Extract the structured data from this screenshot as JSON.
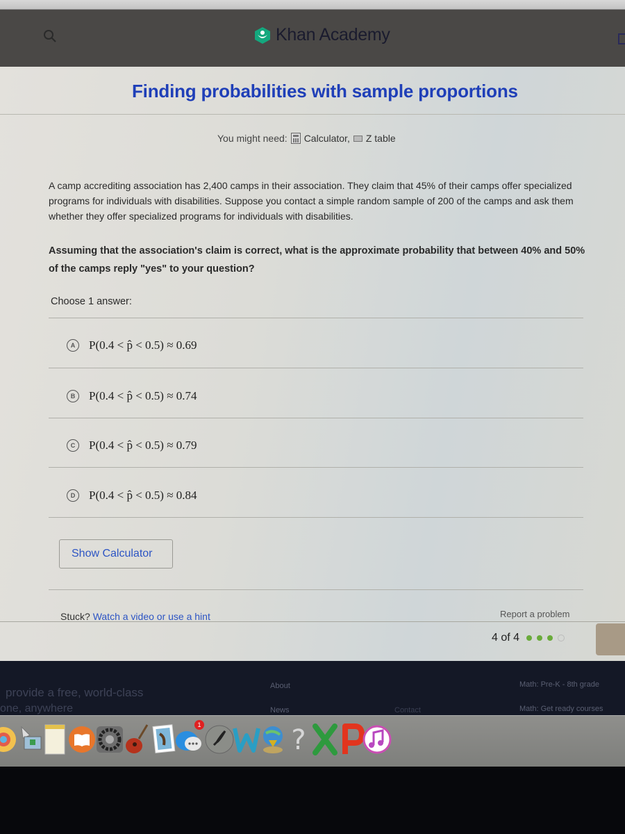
{
  "header": {
    "brand": "Khan Academy",
    "brand_color": "#14bf96"
  },
  "exercise": {
    "title": "Finding probabilities with sample proportions",
    "might_need_label": "You might need:",
    "tools": [
      {
        "label": "Calculator,",
        "icon": "calculator-icon"
      },
      {
        "label": "Z table",
        "icon": "table-icon"
      }
    ],
    "problem_text": "A camp accrediting association has 2,400 camps in their association. They claim that 45% of their camps offer specialized programs for individuals with disabilities. Suppose you contact a simple random sample of 200 of the camps and ask them whether they offer specialized programs for individuals with disabilities.",
    "question_text": "Assuming that the association's claim is correct, what is the approximate probability that between 40% and 50% of the camps reply \"yes\" to your question?",
    "choose_label": "Choose 1 answer:",
    "choices": [
      {
        "letter": "A",
        "text": "P(0.4 < p̂ < 0.5) ≈ 0.69"
      },
      {
        "letter": "B",
        "text": "P(0.4 < p̂ < 0.5) ≈ 0.74"
      },
      {
        "letter": "C",
        "text": "P(0.4 < p̂ < 0.5) ≈ 0.79"
      },
      {
        "letter": "D",
        "text": "P(0.4 < p̂ < 0.5) ≈ 0.84"
      }
    ],
    "show_calculator_label": "Show Calculator",
    "stuck_label": "Stuck?",
    "hint_link": "Watch a video or use a hint",
    "report_link": "Report a problem",
    "progress_text": "4 of 4",
    "progress": {
      "completed": 3,
      "total": 4
    },
    "accent_color": "#1f3fb8",
    "progress_dot_color": "#6aab3b"
  },
  "footer": {
    "mission_line1": "provide a free, world-class",
    "mission_line2": "one, anywhere",
    "links": {
      "about": "About",
      "news": "News",
      "contact": "Contact",
      "math_prek": "Math: Pre-K - 8th grade",
      "math_ready": "Math: Get ready courses"
    }
  },
  "dock": {
    "items": [
      {
        "name": "photos",
        "icon": "photos-icon"
      },
      {
        "name": "boot-camp",
        "icon": "boot-camp-icon"
      },
      {
        "name": "notes",
        "icon": "notes-icon"
      },
      {
        "name": "books",
        "icon": "books-icon"
      },
      {
        "name": "system-preferences",
        "icon": "gear-icon"
      },
      {
        "name": "garageband",
        "icon": "guitar-icon"
      },
      {
        "name": "mail",
        "icon": "mail-stamp-icon"
      },
      {
        "name": "messages",
        "icon": "messages-icon",
        "badge": "1"
      },
      {
        "name": "launchpad",
        "icon": "rocket-icon"
      },
      {
        "name": "word",
        "icon": "word-icon"
      },
      {
        "name": "downloader",
        "icon": "globe-download-icon"
      },
      {
        "name": "help",
        "icon": "question-icon"
      },
      {
        "name": "excel",
        "icon": "excel-icon"
      },
      {
        "name": "powerpoint",
        "icon": "powerpoint-icon"
      },
      {
        "name": "itunes",
        "icon": "music-icon"
      }
    ]
  }
}
